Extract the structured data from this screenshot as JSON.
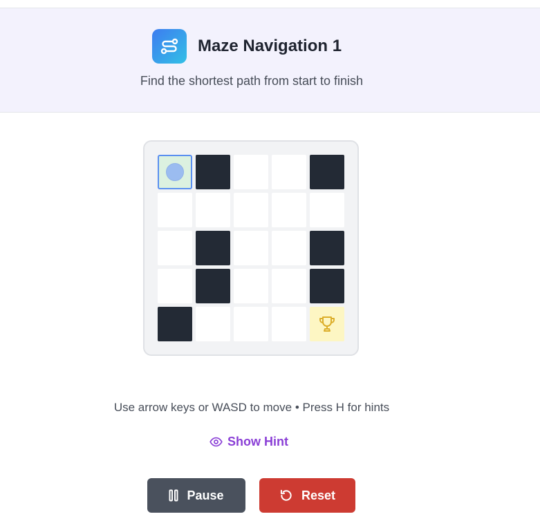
{
  "header": {
    "title": "Maze Navigation 1",
    "subtitle": "Find the shortest path from start to finish",
    "icon": "route-icon",
    "icon_gradient": [
      "#3d7cf0",
      "#33c0e6"
    ]
  },
  "maze": {
    "rows": 5,
    "cols": 5,
    "cells": [
      [
        "start",
        "wall",
        "open",
        "open",
        "wall"
      ],
      [
        "open",
        "open",
        "open",
        "open",
        "open"
      ],
      [
        "open",
        "wall",
        "open",
        "open",
        "wall"
      ],
      [
        "open",
        "wall",
        "open",
        "open",
        "wall"
      ],
      [
        "wall",
        "open",
        "open",
        "open",
        "goal"
      ]
    ],
    "player_position": {
      "row": 0,
      "col": 0
    },
    "goal_icon": "trophy-icon",
    "colors": {
      "wall": "#232a35",
      "open": "#ffffff",
      "start": "#dcf1e0",
      "goal": "#fdf6c3",
      "player": "#9bbcf0"
    }
  },
  "instructions": "Use arrow keys or WASD to move • Press H for hints",
  "hint": {
    "label": "Show Hint",
    "icon": "eye-icon",
    "color": "#8a3fd6"
  },
  "controls": {
    "pause": {
      "label": "Pause",
      "icon": "pause-icon",
      "color": "#4a515d"
    },
    "reset": {
      "label": "Reset",
      "icon": "reset-icon",
      "color": "#cd3b32"
    }
  }
}
